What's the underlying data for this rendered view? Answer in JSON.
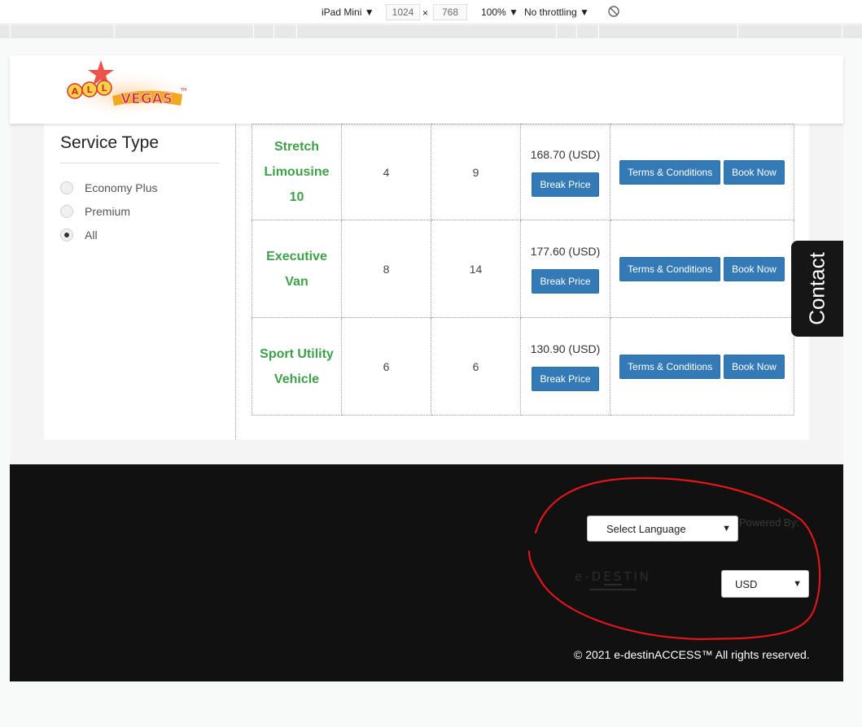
{
  "devtools": {
    "device": "iPad Mini",
    "width": "1024",
    "times": "×",
    "height": "768",
    "zoom": "100%",
    "throttling": "No throttling",
    "dropdown_arrow": "▼"
  },
  "sidebar": {
    "title": "Service Type",
    "options": [
      {
        "label": "Economy Plus",
        "checked": false
      },
      {
        "label": "Premium",
        "checked": false
      },
      {
        "label": "All",
        "checked": true
      }
    ]
  },
  "vehicles": [
    {
      "name_lines": [
        "Stretch",
        "Limousine",
        "10"
      ],
      "passengers": "4",
      "luggage": "9",
      "price": "168.70 (USD)"
    },
    {
      "name_lines": [
        "Executive",
        "Van"
      ],
      "passengers": "8",
      "luggage": "14",
      "price": "177.60 (USD)"
    },
    {
      "name_lines": [
        "Sport Utility",
        "Vehicle"
      ],
      "passengers": "6",
      "luggage": "6",
      "price": "130.90 (USD)"
    }
  ],
  "buttons": {
    "break_price": "Break Price",
    "terms": "Terms & Conditions",
    "book_now": "Book Now"
  },
  "contact": "Contact",
  "footer": {
    "powered_by": "Powered By:",
    "language_select": "Select Language",
    "currency_select": "USD",
    "copyright": "© 2021 e-destinACCESS™ All rights reserved."
  },
  "colors": {
    "primary_button": "#337ab7",
    "vehicle_name": "#3fa04a",
    "footer_bg": "#111111",
    "annotation": "#e0161a"
  },
  "icons": {
    "rotate": "rotate-icon",
    "chevron": "chevron-down-icon"
  }
}
